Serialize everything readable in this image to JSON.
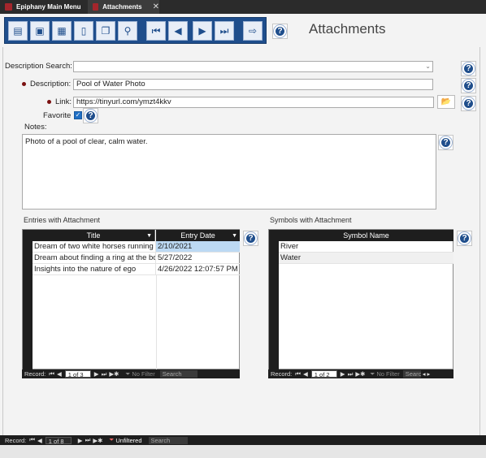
{
  "tabs": [
    {
      "label": "Epiphany Main Menu"
    },
    {
      "label": "Attachments"
    }
  ],
  "toolbar": {
    "buttons": [
      "open-icon",
      "save-close-icon",
      "calendar-icon",
      "delete-icon",
      "copy-icon",
      "find-icon",
      "first-record-icon",
      "previous-record-icon",
      "next-record-icon",
      "last-record-icon",
      "exit-icon"
    ]
  },
  "form": {
    "title": "Attachments",
    "description_search_label": "Description Search:",
    "description_search_value": "",
    "description_label": "Description:",
    "description_value": "Pool of Water Photo",
    "link_label": "Link:",
    "link_value": "https://tinyurl.com/ymzt4kkv",
    "favorite_label": "Favorite",
    "favorite_checked": true,
    "notes_label": "Notes:",
    "notes_value": "Photo of a pool of clear, calm water."
  },
  "entries": {
    "label": "Entries with Attachment",
    "columns": [
      "Title",
      "Entry Date"
    ],
    "rows": [
      {
        "title": "Dream of two white horses running",
        "date": "2/10/2021"
      },
      {
        "title": "Dream about finding a ring at the bo",
        "date": "5/27/2022"
      },
      {
        "title": "Insights into the nature of ego",
        "date": "4/26/2022 12:07:57 PM"
      }
    ],
    "nav": {
      "record_label": "Record:",
      "position": "1 of 3",
      "filter": "No Filter",
      "search": "Search"
    }
  },
  "symbols": {
    "label": "Symbols with Attachment",
    "columns": [
      "Symbol Name"
    ],
    "rows": [
      {
        "name": "River"
      },
      {
        "name": "Water"
      }
    ],
    "nav": {
      "record_label": "Record:",
      "position": "1 of 2",
      "filter": "No Filter",
      "search": "Searc"
    }
  },
  "main_nav": {
    "record_label": "Record:",
    "position": "1 of 8",
    "filter": "Unfiltered",
    "search": "Search"
  },
  "colors": {
    "accent": "#1f4e8c",
    "required": "#7a1010",
    "selected_cell": "#bcd9f3"
  }
}
